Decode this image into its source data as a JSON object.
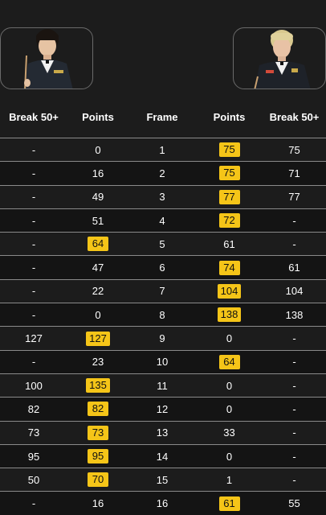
{
  "columns": {
    "break_left": "Break 50+",
    "points_left": "Points",
    "frame": "Frame",
    "points_right": "Points",
    "break_right": "Break 50+"
  },
  "colors": {
    "winner_badge": "#f5c518",
    "background": "#1c1c1c"
  },
  "rows": [
    {
      "bl": "-",
      "pl": "0",
      "frame": "1",
      "pr": "75",
      "br": "75",
      "winner": "right"
    },
    {
      "bl": "-",
      "pl": "16",
      "frame": "2",
      "pr": "75",
      "br": "71",
      "winner": "right"
    },
    {
      "bl": "-",
      "pl": "49",
      "frame": "3",
      "pr": "77",
      "br": "77",
      "winner": "right"
    },
    {
      "bl": "-",
      "pl": "51",
      "frame": "4",
      "pr": "72",
      "br": "-",
      "winner": "right"
    },
    {
      "bl": "-",
      "pl": "64",
      "frame": "5",
      "pr": "61",
      "br": "-",
      "winner": "left"
    },
    {
      "bl": "-",
      "pl": "47",
      "frame": "6",
      "pr": "74",
      "br": "61",
      "winner": "right"
    },
    {
      "bl": "-",
      "pl": "22",
      "frame": "7",
      "pr": "104",
      "br": "104",
      "winner": "right"
    },
    {
      "bl": "-",
      "pl": "0",
      "frame": "8",
      "pr": "138",
      "br": "138",
      "winner": "right"
    },
    {
      "bl": "127",
      "pl": "127",
      "frame": "9",
      "pr": "0",
      "br": "-",
      "winner": "left"
    },
    {
      "bl": "-",
      "pl": "23",
      "frame": "10",
      "pr": "64",
      "br": "-",
      "winner": "right"
    },
    {
      "bl": "100",
      "pl": "135",
      "frame": "11",
      "pr": "0",
      "br": "-",
      "winner": "left"
    },
    {
      "bl": "82",
      "pl": "82",
      "frame": "12",
      "pr": "0",
      "br": "-",
      "winner": "left"
    },
    {
      "bl": "73",
      "pl": "73",
      "frame": "13",
      "pr": "33",
      "br": "-",
      "winner": "left"
    },
    {
      "bl": "95",
      "pl": "95",
      "frame": "14",
      "pr": "0",
      "br": "-",
      "winner": "left"
    },
    {
      "bl": "50",
      "pl": "70",
      "frame": "15",
      "pr": "1",
      "br": "-",
      "winner": "left"
    },
    {
      "bl": "-",
      "pl": "16",
      "frame": "16",
      "pr": "61",
      "br": "55",
      "winner": "right"
    }
  ]
}
